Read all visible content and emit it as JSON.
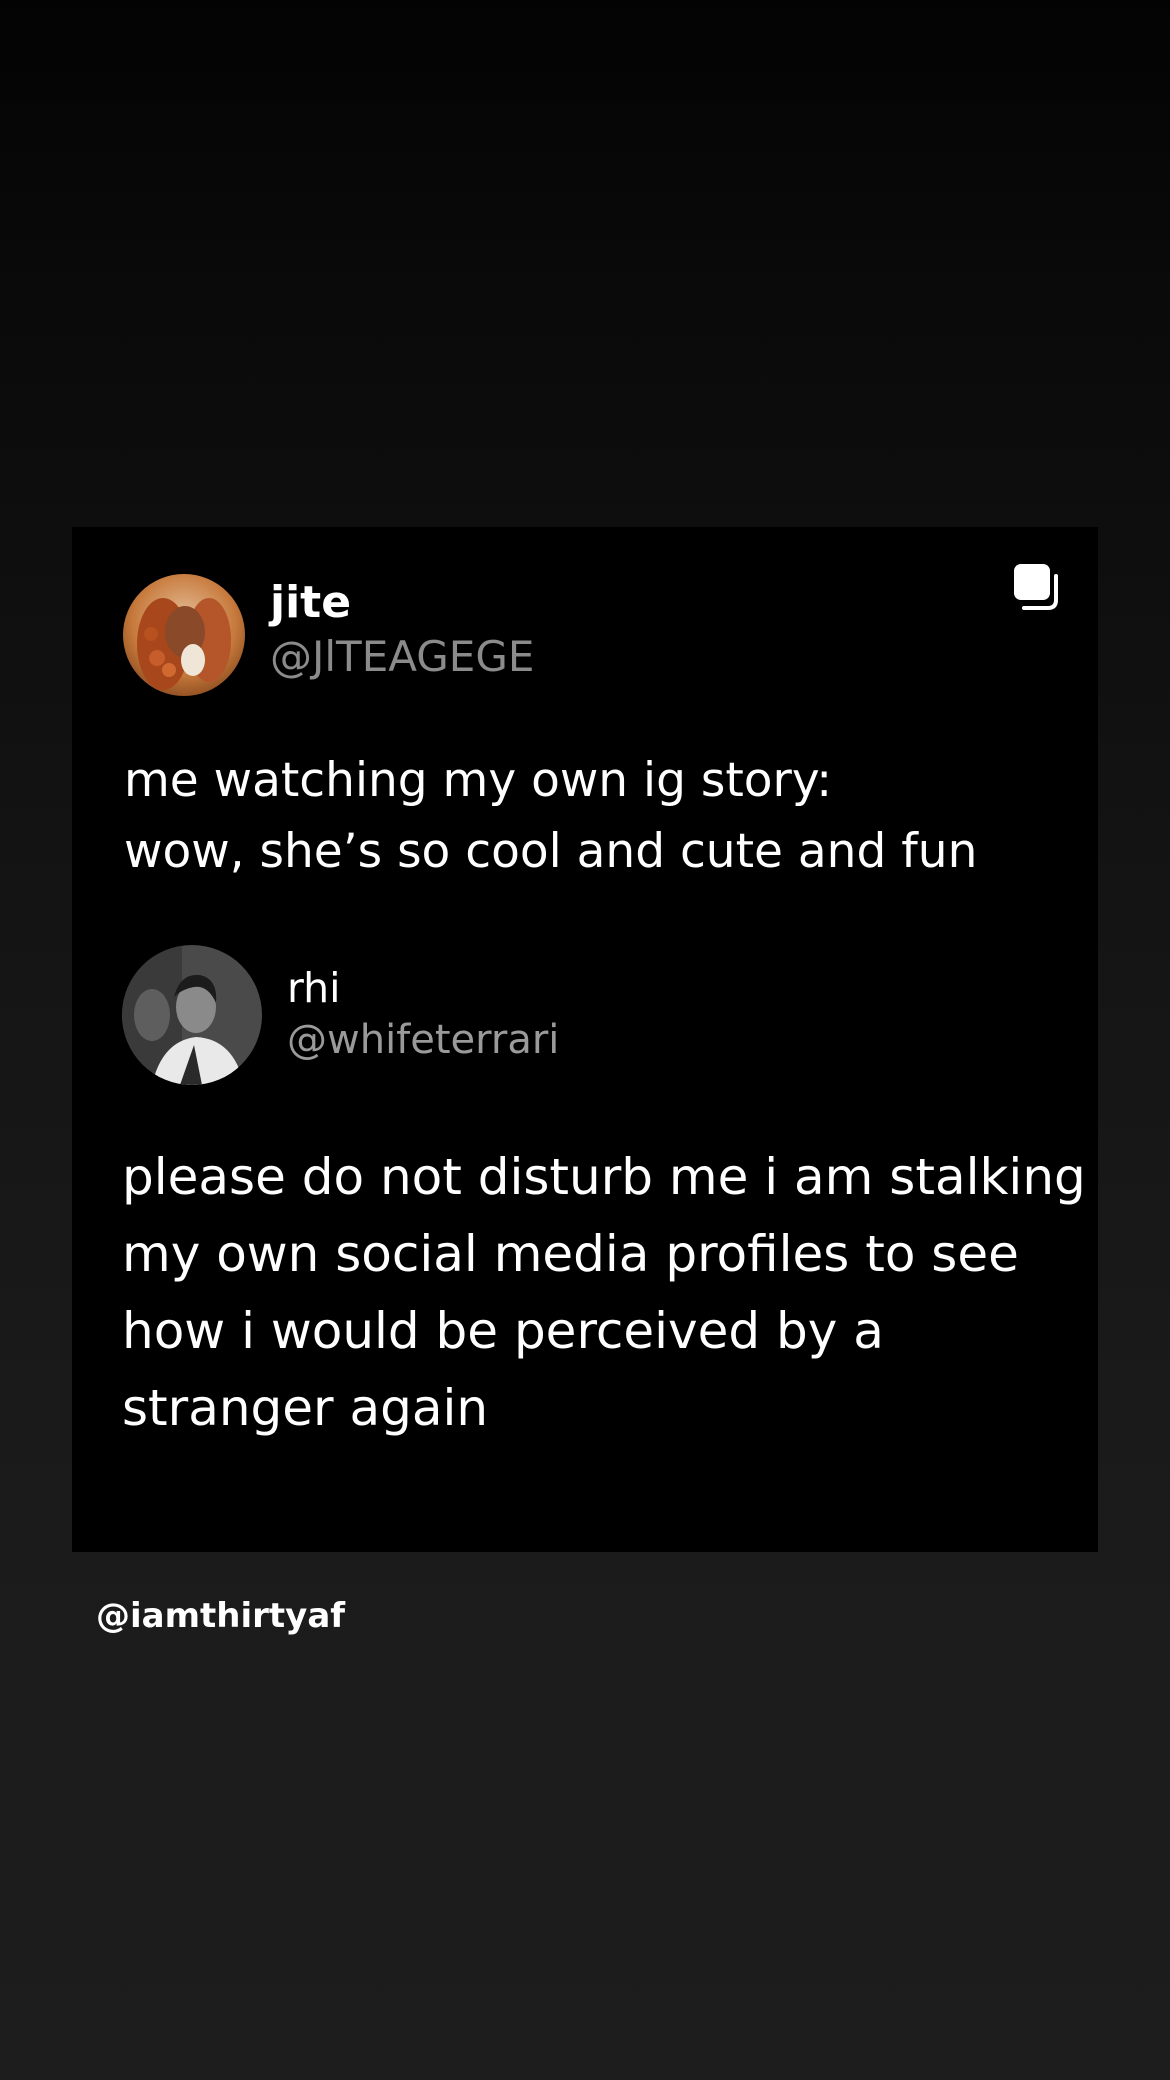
{
  "post": {
    "icon": "multiple-posts-icon",
    "tweet": {
      "display_name": "jite",
      "handle": "@JlTEAGEGE",
      "avatar": "avatar-photo",
      "text_lines": [
        "me watching my own ig story:",
        "wow, she’s so cool and cute and fun"
      ]
    },
    "reply": {
      "display_name": "rhi",
      "handle": "@whifeterrari",
      "avatar": "avatar-photo",
      "text_lines": [
        "please do not disturb me i am stalking",
        "my own social media profiles to see",
        "how i would be perceived by a",
        "stranger again"
      ]
    }
  },
  "watermark": {
    "handle": "@iamthirtyaf"
  },
  "colors": {
    "card_background": "#000000",
    "page_background": "#1d1d1d",
    "handle_gray": "#8b8b8b"
  }
}
